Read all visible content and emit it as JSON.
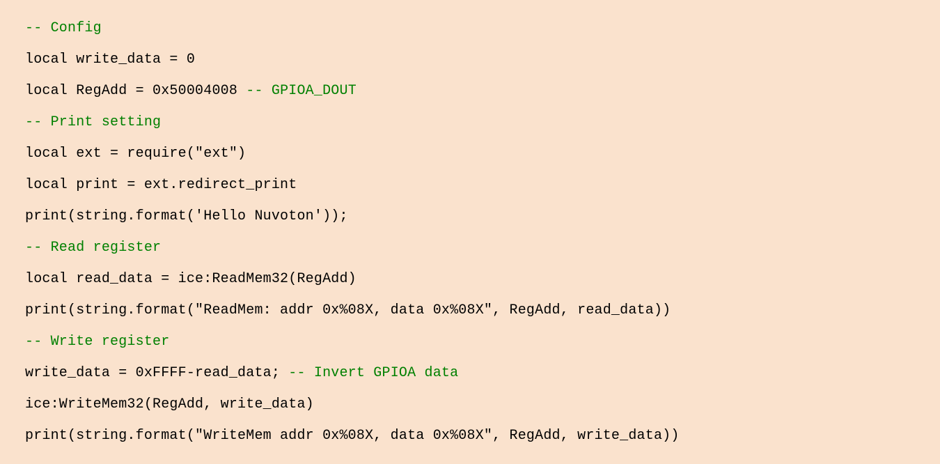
{
  "code": {
    "lines": [
      {
        "segments": [
          {
            "text": "-- Config",
            "cls": "comment"
          }
        ]
      },
      {
        "segments": [
          {
            "text": "local write_data = 0",
            "cls": ""
          }
        ]
      },
      {
        "segments": [
          {
            "text": "local RegAdd = 0x50004008 ",
            "cls": ""
          },
          {
            "text": "-- GPIOA_DOUT",
            "cls": "comment"
          }
        ]
      },
      {
        "segments": [
          {
            "text": "-- Print setting",
            "cls": "comment"
          }
        ]
      },
      {
        "segments": [
          {
            "text": "local ext = require(\"ext\")",
            "cls": ""
          }
        ]
      },
      {
        "segments": [
          {
            "text": "local print = ext.redirect_print",
            "cls": ""
          }
        ]
      },
      {
        "segments": [
          {
            "text": "print(string.format('Hello Nuvoton'));",
            "cls": ""
          }
        ]
      },
      {
        "segments": [
          {
            "text": "-- Read register",
            "cls": "comment"
          }
        ]
      },
      {
        "segments": [
          {
            "text": "local read_data = ice:ReadMem32(RegAdd)",
            "cls": ""
          }
        ]
      },
      {
        "segments": [
          {
            "text": "print(string.format(\"ReadMem: addr 0x%08X, data 0x%08X\", RegAdd, read_data))",
            "cls": ""
          }
        ]
      },
      {
        "segments": [
          {
            "text": "-- Write register",
            "cls": "comment"
          }
        ]
      },
      {
        "segments": [
          {
            "text": "write_data = 0xFFFF-read_data; ",
            "cls": ""
          },
          {
            "text": "-- Invert GPIOA data",
            "cls": "comment"
          }
        ]
      },
      {
        "segments": [
          {
            "text": "ice:WriteMem32(RegAdd, write_data)",
            "cls": ""
          }
        ]
      },
      {
        "segments": [
          {
            "text": "print(string.format(\"WriteMem addr 0x%08X, data 0x%08X\", RegAdd, write_data))",
            "cls": ""
          }
        ]
      }
    ]
  }
}
